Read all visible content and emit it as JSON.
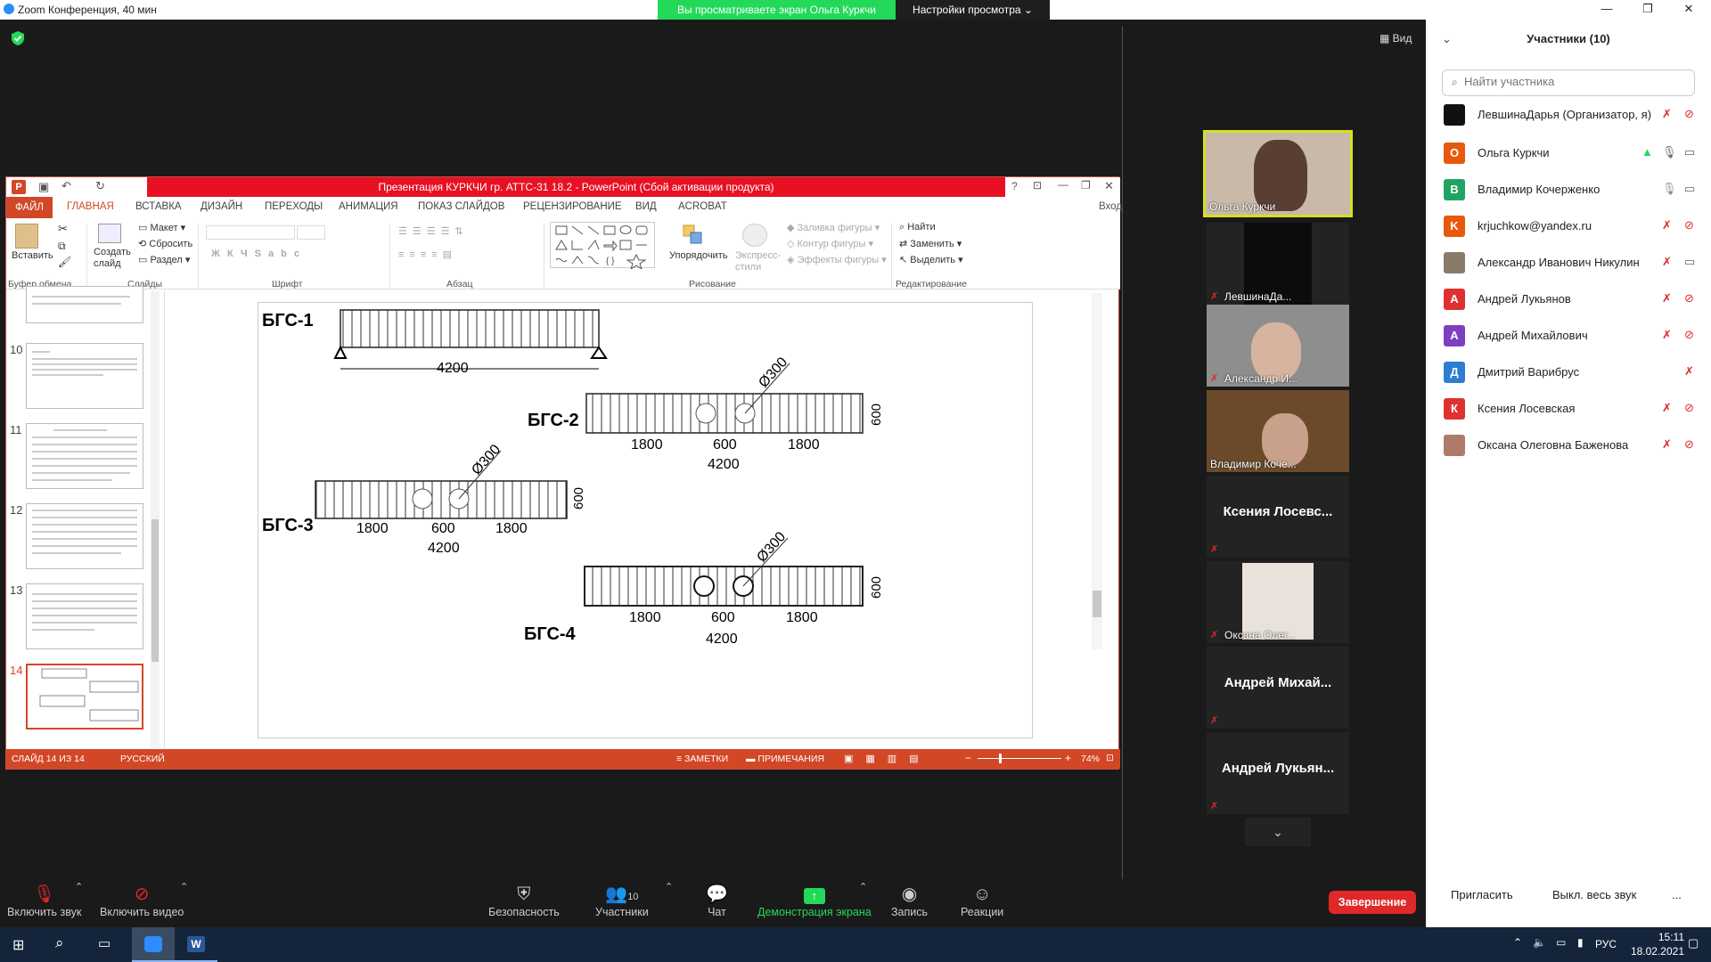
{
  "zoom": {
    "title": "Zoom Конференция, 40 мин",
    "banner": "Вы просматриваете экран Ольга Куркчи",
    "view_settings": "Настройки просмотра",
    "view_label": "Вид"
  },
  "ppt": {
    "title": "Презентация КУРКЧИ гр. АТТС-31 18.2 - PowerPoint (Сбой активации продукта)",
    "login": "Вход",
    "tabs": [
      "ФАЙЛ",
      "ГЛАВНАЯ",
      "ВСТАВКА",
      "ДИЗАЙН",
      "ПЕРЕХОДЫ",
      "АНИМАЦИЯ",
      "ПОКАЗ СЛАЙДОВ",
      "РЕЦЕНЗИРОВАНИЕ",
      "ВИД",
      "ACROBAT"
    ],
    "ribbon": {
      "paste": "Вставить",
      "create_slide": "Создать слайд",
      "layout": "Макет",
      "reset": "Сбросить",
      "section": "Раздел",
      "arrange": "Упорядочить",
      "express_styles": "Экспресс-стили",
      "shape_fill": "Заливка фигуры",
      "shape_outline": "Контур фигуры",
      "shape_effects": "Эффекты фигуры",
      "find": "Найти",
      "replace": "Заменить",
      "select": "Выделить",
      "groups": [
        "Буфер обмена",
        "Слайды",
        "Шрифт",
        "Абзац",
        "Рисование",
        "Редактирование"
      ]
    },
    "thumb_numbers": [
      "10",
      "11",
      "12",
      "13",
      "14"
    ],
    "status": {
      "slide": "СЛАЙД 14 ИЗ 14",
      "lang": "РУССКИЙ",
      "notes": "ЗАМЕТКИ",
      "comments": "ПРИМЕЧАНИЯ",
      "zoom": "74%"
    }
  },
  "slide": {
    "labels": [
      "БГС-1",
      "БГС-2",
      "БГС-3",
      "БГС-4"
    ],
    "dims": {
      "total": "4200",
      "side": "1800",
      "mid": "600",
      "height": "600",
      "diam": "Ø300"
    }
  },
  "videos": [
    {
      "name": "Ольга Куркчи",
      "active": true
    },
    {
      "name": "ЛевшинаДа...",
      "muted": true
    },
    {
      "name": "Александр И...",
      "muted": true
    },
    {
      "name": "Владимир Коче..."
    },
    {
      "big": "Ксения  Лосевс...",
      "muted": true
    },
    {
      "name": "Оксана Олег...",
      "muted": true
    },
    {
      "big": "Андрей  Михай...",
      "muted": true
    },
    {
      "big": "Андрей  Лукьян...",
      "muted": true
    }
  ],
  "participants_panel": {
    "title": "Участники (10)",
    "search_placeholder": "Найти участника",
    "list": [
      {
        "initial": "",
        "name": "ЛевшинаДарья (Организатор, я)",
        "color": "#111111"
      },
      {
        "initial": "О",
        "name": "Ольга Куркчи",
        "color": "#e8590c"
      },
      {
        "initial": "В",
        "name": "Владимир Кочерженко",
        "color": "#1fa463"
      },
      {
        "initial": "K",
        "name": "krjuchkow@yandex.ru",
        "color": "#e8590c"
      },
      {
        "initial": "",
        "name": "Александр Иванович Никулин",
        "color": "#8a7a6a"
      },
      {
        "initial": "А",
        "name": "Андрей Лукьянов",
        "color": "#e03131"
      },
      {
        "initial": "А",
        "name": "Андрей Михайлович",
        "color": "#7e3fbf"
      },
      {
        "initial": "Д",
        "name": "Дмитрий Варибрус",
        "color": "#2d7dd2"
      },
      {
        "initial": "К",
        "name": "Ксения Лосевская",
        "color": "#e03131"
      },
      {
        "initial": "",
        "name": "Оксана Олеговна Баженова",
        "color": "#b07a6a"
      }
    ],
    "invite": "Пригласить",
    "mute_all": "Выкл. весь звук",
    "more": "..."
  },
  "toolbar": {
    "mic": "Включить звук",
    "video": "Включить видео",
    "security": "Безопасность",
    "participants": "Участники",
    "participants_count": "10",
    "chat": "Чат",
    "share": "Демонстрация экрана",
    "record": "Запись",
    "reactions": "Реакции",
    "end": "Завершение"
  },
  "taskbar": {
    "lang": "РУС",
    "time": "15:11",
    "date": "18.02.2021"
  }
}
